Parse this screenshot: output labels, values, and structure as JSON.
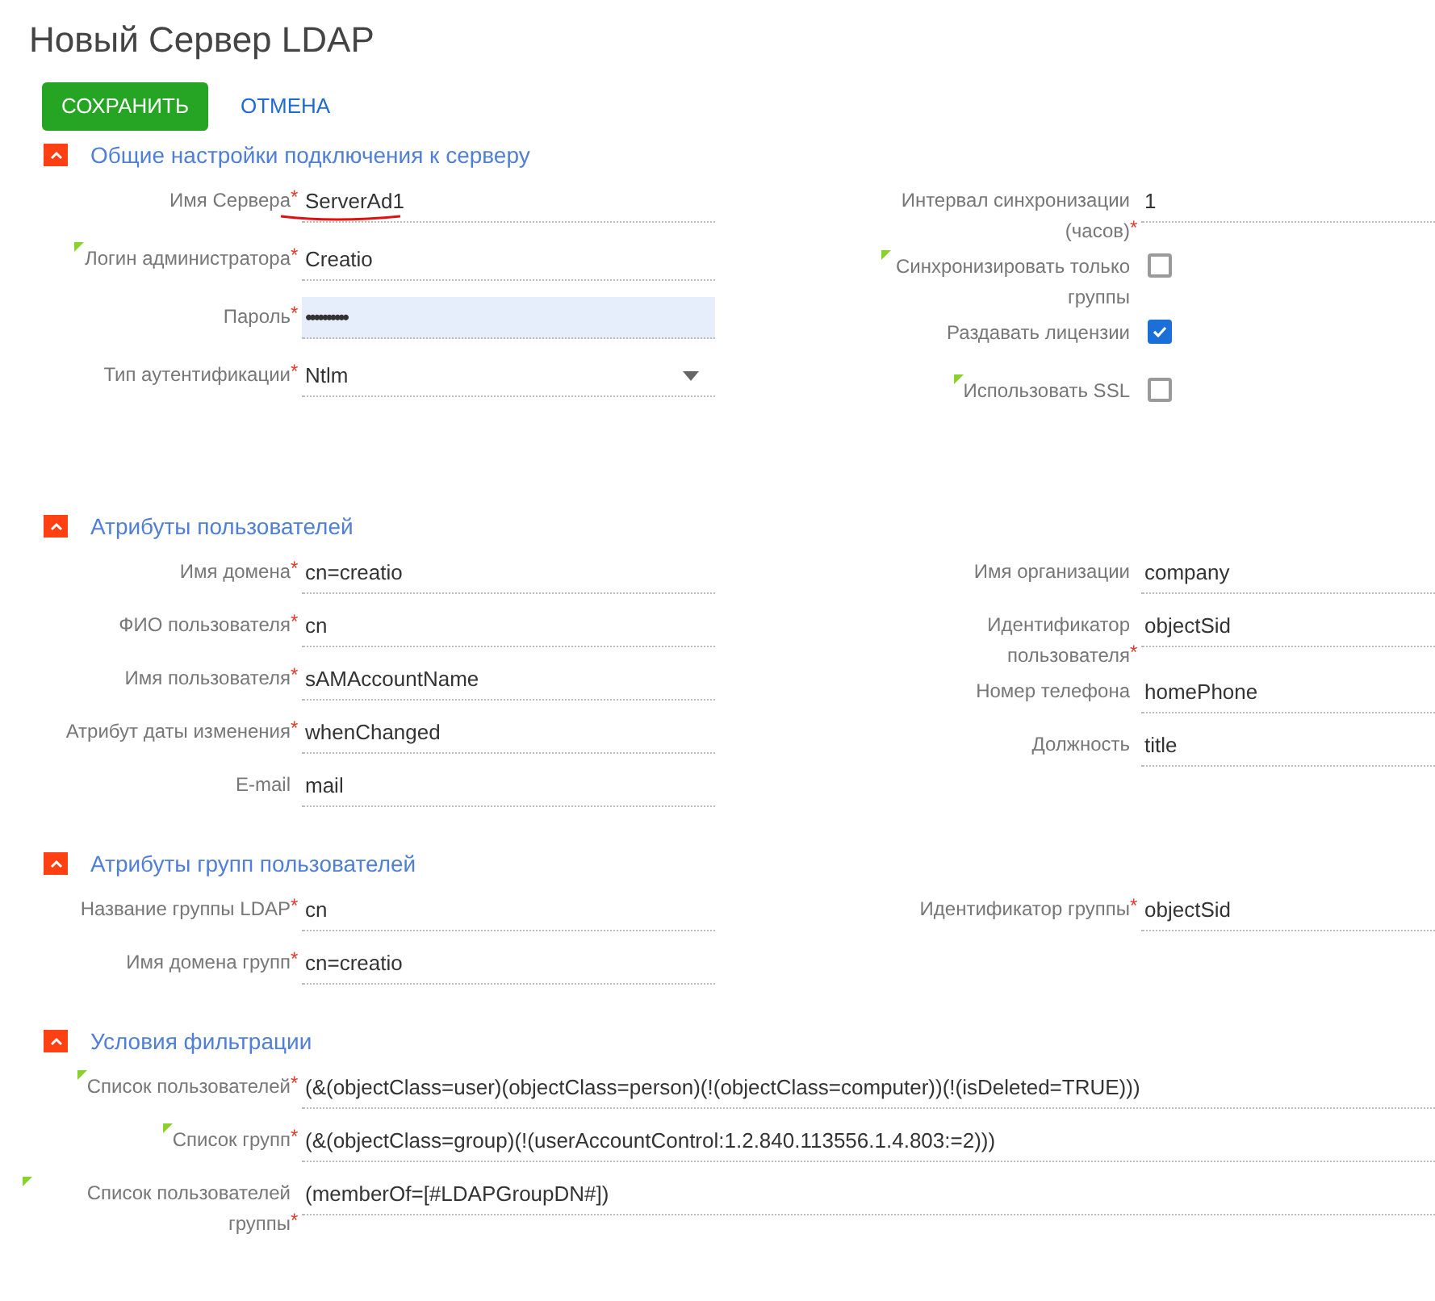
{
  "title": "Новый Сервер LDAP",
  "buttons": [
    {
      "label": "СОХРАНИТЬ",
      "kind": "primary"
    },
    {
      "label": "ОТМЕНА",
      "kind": "link"
    }
  ],
  "sections": [
    {
      "title": "Общие настройки подключения к серверу",
      "expanded": true,
      "left": [
        {
          "label": "Имя Сервера",
          "required_mark": "*",
          "hint": false,
          "kind": "text",
          "value": "ServerAd1",
          "annotated": true
        },
        {
          "label": "Логин администратора",
          "required_mark": "*",
          "hint": true,
          "kind": "text",
          "value": "Creatio"
        },
        {
          "label": "Пароль",
          "required_mark": "*",
          "hint": false,
          "kind": "password",
          "value": "••••••••••",
          "focused": true
        },
        {
          "label": "Тип аутентификации",
          "required_mark": "*",
          "hint": false,
          "kind": "select",
          "value": "Ntlm"
        }
      ],
      "right": [
        {
          "label": "Интервал синхронизации (часов)",
          "required_mark": "*",
          "hint": false,
          "kind": "text",
          "value": "1"
        },
        {
          "label": "Синхронизировать только группы",
          "hint": true,
          "kind": "checkbox",
          "checked": false
        },
        {
          "label": "Раздавать лицензии",
          "hint": false,
          "kind": "checkbox",
          "checked": true
        },
        {
          "label": "Использовать SSL",
          "hint": true,
          "kind": "checkbox",
          "checked": false
        }
      ]
    },
    {
      "title": "Атрибуты пользователей",
      "expanded": true,
      "left": [
        {
          "label": "Имя домена",
          "required_mark": "*",
          "hint": false,
          "kind": "text",
          "value": "cn=creatio"
        },
        {
          "label": "ФИО пользователя",
          "required_mark": "*",
          "hint": false,
          "kind": "text",
          "value": "cn"
        },
        {
          "label": "Имя пользователя",
          "required_mark": "*",
          "hint": false,
          "kind": "text",
          "value": "sAMAccountName"
        },
        {
          "label": "Атрибут даты изменения",
          "required_mark": "*",
          "hint": false,
          "kind": "text",
          "value": "whenChanged"
        },
        {
          "label": "E-mail",
          "hint": false,
          "kind": "text",
          "value": "mail"
        }
      ],
      "right": [
        {
          "label": "Имя организации",
          "hint": false,
          "kind": "text",
          "value": "company"
        },
        {
          "label": "Идентификатор пользователя",
          "required_mark": "*",
          "hint": false,
          "kind": "text",
          "value": "objectSid"
        },
        {
          "label": "Номер телефона",
          "hint": false,
          "kind": "text",
          "value": "homePhone"
        },
        {
          "label": "Должность",
          "hint": false,
          "kind": "text",
          "value": "title"
        }
      ]
    },
    {
      "title": "Атрибуты групп пользователей",
      "expanded": true,
      "left": [
        {
          "label": "Название группы LDAP",
          "required_mark": "*",
          "hint": false,
          "kind": "text",
          "value": "cn"
        },
        {
          "label": "Имя домена групп",
          "required_mark": "*",
          "hint": false,
          "kind": "text",
          "value": "cn=creatio"
        }
      ],
      "right": [
        {
          "label": "Идентификатор группы",
          "required_mark": "*",
          "hint": false,
          "kind": "text",
          "value": "objectSid"
        }
      ]
    },
    {
      "title": "Условия фильтрации",
      "expanded": true,
      "full": [
        {
          "label": "Список пользователей",
          "required_mark": "*",
          "hint": true,
          "kind": "text",
          "value": "(&(objectClass=user)(objectClass=person)(!(objectClass=computer))(!(isDeleted=TRUE)))"
        },
        {
          "label": "Список групп",
          "required_mark": "*",
          "hint": true,
          "kind": "text",
          "value": "(&(objectClass=group)(!(userAccountControl:1.2.840.113556.1.4.803:=2)))"
        },
        {
          "label": "Список пользователей группы",
          "required_mark": "*",
          "hint": true,
          "kind": "text",
          "value": "(memberOf=[#LDAPGroupDN#])"
        }
      ]
    }
  ]
}
